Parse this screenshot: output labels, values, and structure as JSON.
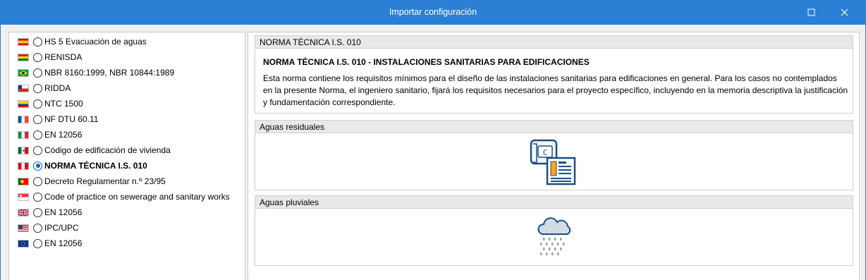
{
  "window": {
    "title": "Importar configuración",
    "maximize_icon": "maximize-icon",
    "close_icon": "close-icon",
    "accent_color": "#2b7fd4"
  },
  "options": [
    {
      "label": "HS 5 Evacuación de aguas",
      "flag": "spain-flag-icon",
      "selected": false
    },
    {
      "label": "RENISDA",
      "flag": "bolivia-flag-icon",
      "selected": false
    },
    {
      "label": "NBR 8160:1999, NBR 10844:1989",
      "flag": "brazil-flag-icon",
      "selected": false
    },
    {
      "label": "RIDDA",
      "flag": "chile-flag-icon",
      "selected": false
    },
    {
      "label": "NTC 1500",
      "flag": "colombia-flag-icon",
      "selected": false
    },
    {
      "label": "NF DTU 60.11",
      "flag": "france-flag-icon",
      "selected": false
    },
    {
      "label": "EN 12056",
      "flag": "italy-flag-icon",
      "selected": false
    },
    {
      "label": "Código de edificación de vivienda",
      "flag": "mexico-flag-icon",
      "selected": false
    },
    {
      "label": "NORMA TÉCNICA I.S. 010",
      "flag": "peru-flag-icon",
      "selected": true
    },
    {
      "label": "Decreto Regulamentar n.º 23/95",
      "flag": "portugal-flag-icon",
      "selected": false
    },
    {
      "label": "Code of practice on sewerage and sanitary works",
      "flag": "singapore-flag-icon",
      "selected": false
    },
    {
      "label": "EN 12056",
      "flag": "uk-flag-icon",
      "selected": false
    },
    {
      "label": "IPC/UPC",
      "flag": "usa-flag-icon",
      "selected": false
    },
    {
      "label": "EN 12056",
      "flag": "eu-flag-icon",
      "selected": false
    }
  ],
  "detail": {
    "header": "NORMA TÉCNICA I.S. 010",
    "title": "NORMA TÉCNICA I.S. 010 - INSTALACIONES SANITARIAS PARA EDIFICACIONES",
    "description": "Esta norma contiene los requisitos mínimos para el diseño de las instalaciones sanitarias para edificaciones en general. Para los casos no contemplados en la presente Norma, el ingeniero sanitario, fijará los requisitos necesarios para el proyecto específico, incluyendo en la memoria descriptiva la justificación y fundamentación correspondiente."
  },
  "sections": [
    {
      "header": "Aguas residuales",
      "icon": "wastewater-icon"
    },
    {
      "header": "Aguas pluviales",
      "icon": "rain-cloud-icon"
    }
  ]
}
